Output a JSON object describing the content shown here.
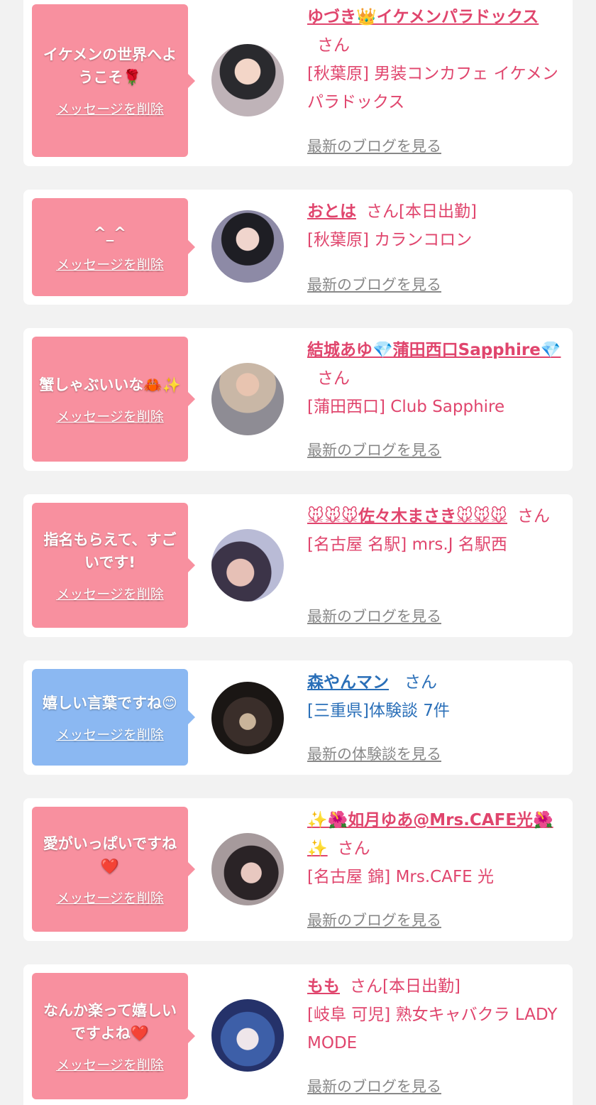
{
  "delete_label": "メッセージを削除",
  "cards": [
    {
      "message": "イケメンの世界へようこそ🌹",
      "name": "ゆづき👑イケメンパラドックス",
      "suffix": "さん",
      "shop": "[秋葉原] 男装コンカフェ イケメンパラドックス",
      "blog": "最新のブログを見る"
    },
    {
      "message": "^_^",
      "name": "おとは",
      "suffix": "さん[本日出勤]",
      "shop": "[秋葉原] カランコロン",
      "blog": "最新のブログを見る"
    },
    {
      "message": "蟹しゃぶいいな🦀✨",
      "name": "結城あゆ💎蒲田西口Sapphire💎",
      "suffix": "さん",
      "shop": "[蒲田西口] Club Sapphire",
      "blog": "最新のブログを見る"
    },
    {
      "message": "指名もらえて、すごいです!",
      "name": "🐭🐭🐭佐々木まさき🐭🐭🐭",
      "suffix": "さん",
      "shop": "[名古屋 名駅] mrs.J 名駅西",
      "blog": "最新のブログを見る"
    },
    {
      "message": "嬉しい言葉ですね😊",
      "name": "森やんマン",
      "suffix": "さん",
      "shop": "[三重県]体験談 7件",
      "blog": "最新の体験談を見る"
    },
    {
      "message": "愛がいっぱいですね❤️",
      "name": "✨🌺如月ゆあ@Mrs.CAFE光🌺✨",
      "suffix": "さん",
      "shop": "[名古屋 錦] Mrs.CAFE 光",
      "blog": "最新のブログを見る"
    },
    {
      "message": "なんか楽って嬉しいですよね❤️",
      "name": "もも",
      "suffix": "さん[本日出勤]",
      "shop": "[岐阜 可児] 熟女キャバクラ LADY MODE",
      "blog": "最新のブログを見る"
    }
  ]
}
